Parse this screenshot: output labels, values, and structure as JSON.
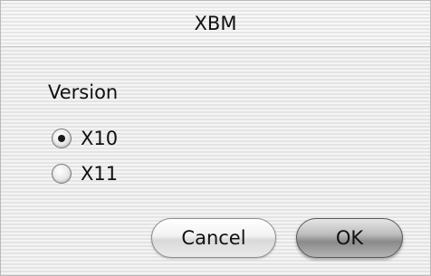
{
  "window": {
    "title": "XBM"
  },
  "version_group": {
    "label": "Version",
    "options": [
      {
        "label": "X10",
        "selected": true
      },
      {
        "label": "X11",
        "selected": false
      }
    ]
  },
  "buttons": {
    "cancel_label": "Cancel",
    "ok_label": "OK"
  }
}
